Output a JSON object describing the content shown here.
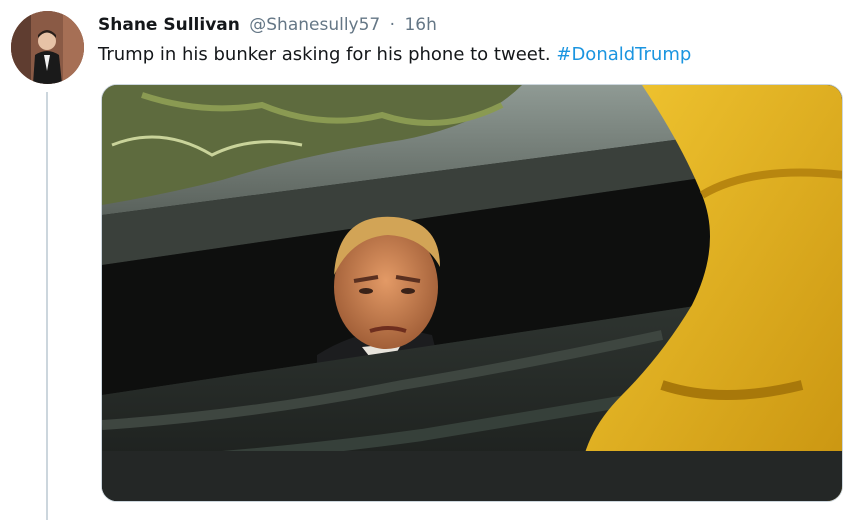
{
  "tweet": {
    "author": {
      "display_name": "Shane Sullivan",
      "handle": "@Shanesully57",
      "separator": "·",
      "time_ago": "16h"
    },
    "text": "Trump in his bunker asking for his phone to tweet.",
    "hashtag": "#DonaldTrump",
    "media": {
      "description_icon": "storm-drain-meme-image"
    }
  },
  "colors": {
    "name": "#14171a",
    "meta": "#657786",
    "hashtag": "#1b95e0",
    "thread_line": "#ccd6dd",
    "raincoat_yellow": "#e8b61c"
  }
}
